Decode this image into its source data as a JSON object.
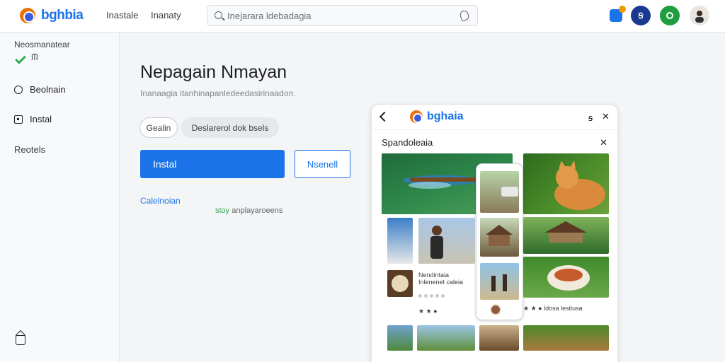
{
  "header": {
    "brand": "bghbia",
    "nav": [
      "Inastale",
      "Inanaty"
    ],
    "search_placeholder": "Inejarara ldebadagia",
    "icons": [
      "notifications-icon",
      "profile-badge-icon",
      "apps-icon",
      "avatar"
    ],
    "badge_label": "Ꞩ",
    "colors": {
      "accent": "#1a73e8",
      "green": "#34a853",
      "navy": "#1b3a8f"
    }
  },
  "sidebar": {
    "section_label": "Neosmanatear",
    "section_sub": "ᙏ",
    "items": [
      {
        "label": "Beolnain",
        "icon": "circle-icon"
      },
      {
        "label": "Instal",
        "icon": "square-icon"
      }
    ],
    "footer_label": "Reotels"
  },
  "main": {
    "title": "Nepagain Nmayan",
    "subtitle": "Inanaagia itanhinapanledeedasirinaadon.",
    "chips": [
      "Gealin",
      "Deslarerol dok bsels"
    ],
    "primary_button": "Instal",
    "secondary_button": "Nsenell",
    "link": "Calelnoian",
    "hint_prefix": "stoy",
    "hint_text": "anplayaroeens"
  },
  "preview": {
    "brand": "bghaia",
    "controls": [
      "ꟊ",
      "✕"
    ],
    "title": "Spandoleaia",
    "close": "✕",
    "post_text": "Nendintaia Inlenenet caleia",
    "caption_left": "★ ★ ●",
    "caption_right": "★ ★ ●  ldosa lesitusa"
  }
}
